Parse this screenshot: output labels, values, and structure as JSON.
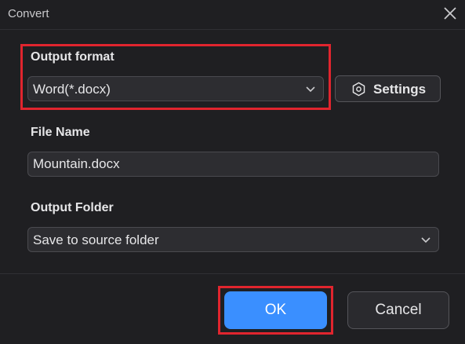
{
  "window": {
    "title": "Convert"
  },
  "output_format": {
    "label": "Output format",
    "selected": "Word(*.docx)"
  },
  "settings_button": {
    "label": "Settings"
  },
  "file_name": {
    "label": "File Name",
    "value": "Mountain.docx"
  },
  "output_folder": {
    "label": "Output Folder",
    "selected": "Save to source folder"
  },
  "buttons": {
    "ok": "OK",
    "cancel": "Cancel"
  },
  "colors": {
    "background": "#1f1f22",
    "field": "#2d2d31",
    "accent": "#3a8fff",
    "highlight": "#e0252e"
  },
  "icons": [
    "close-icon",
    "chevron-down-icon",
    "gear-hexagon-icon"
  ]
}
